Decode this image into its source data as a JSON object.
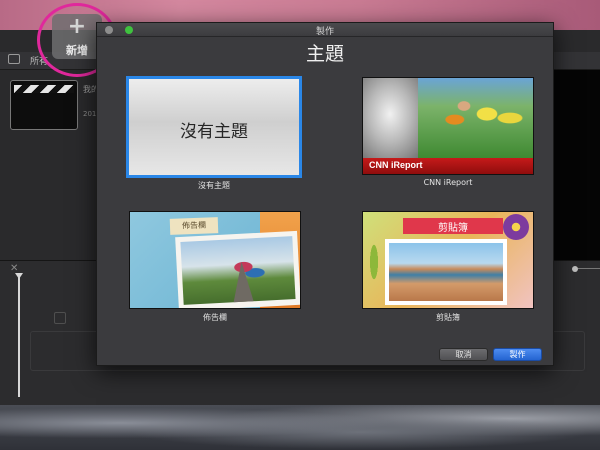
{
  "background_app": {
    "new_button_label": "新增",
    "toolbar_label": "所有",
    "project_name": "我的",
    "project_date": "201",
    "new_button_icon": "plus-icon",
    "highlight_color": "#e0289c"
  },
  "dialog": {
    "window_title": "製作",
    "heading": "主題",
    "themes": [
      {
        "label": "沒有主題",
        "preview_text": "沒有主題",
        "selected": true
      },
      {
        "label": "CNN iReport",
        "preview_text": "CNN iReport",
        "selected": false
      },
      {
        "label": "佈告欄",
        "preview_text": "佈告欄",
        "selected": false
      },
      {
        "label": "剪貼簿",
        "preview_text": "剪貼簿",
        "selected": false
      }
    ],
    "cancel_label": "取消",
    "create_label": "製作",
    "accent_color": "#2a87e8"
  }
}
